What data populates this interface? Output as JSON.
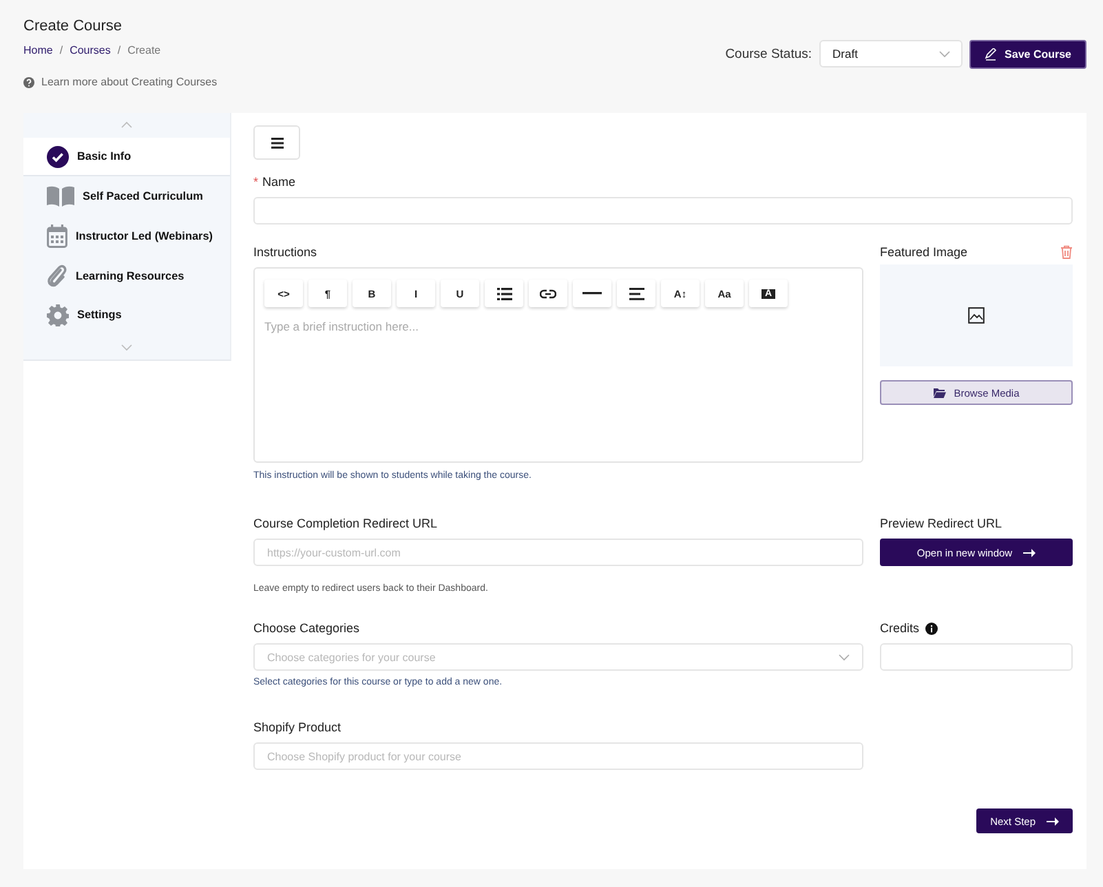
{
  "header": {
    "title": "Create Course",
    "breadcrumbs": [
      {
        "kind": "link",
        "label": "Home"
      },
      {
        "kind": "separator",
        "label": "/"
      },
      {
        "kind": "link",
        "label": "Courses"
      },
      {
        "kind": "separator",
        "label": "/"
      },
      {
        "kind": "current",
        "label": "Create"
      }
    ],
    "help_link": "Learn more about Creating Courses",
    "status_label": "Course Status:",
    "status_value": "Draft",
    "save_button": "Save Course"
  },
  "sidebar": {
    "items": [
      {
        "label": "Basic Info",
        "selected": true
      },
      {
        "label": "Self Paced Curriculum",
        "selected": false
      },
      {
        "label": "Instructor Led (Webinars)",
        "selected": false
      },
      {
        "label": "Learning Resources",
        "selected": false
      },
      {
        "label": "Settings",
        "selected": false
      }
    ]
  },
  "form": {
    "name_label": "Name",
    "required_mark": "*",
    "instructions_label": "Instructions",
    "toolbar": [
      {
        "kind": "text",
        "label": "<>"
      },
      {
        "kind": "text",
        "label": "¶"
      },
      {
        "kind": "text",
        "label": "B"
      },
      {
        "kind": "text",
        "label": "I"
      },
      {
        "kind": "text",
        "label": "U"
      },
      {
        "kind": "list"
      },
      {
        "kind": "link"
      },
      {
        "kind": "rule"
      },
      {
        "kind": "align"
      },
      {
        "kind": "text",
        "label": "A↕"
      },
      {
        "kind": "text",
        "label": "Aa"
      },
      {
        "kind": "inverse",
        "label": "A"
      }
    ],
    "instructions_placeholder": "Type a brief instruction here...",
    "instructions_help": "This instruction will be shown to students while taking the course.",
    "featured_image_label": "Featured Image",
    "browse_button": "Browse Media",
    "redirect_label": "Course Completion Redirect URL",
    "redirect_placeholder": "https://your-custom-url.com",
    "redirect_help": "Leave empty to redirect users back to their Dashboard.",
    "preview_label": "Preview Redirect URL",
    "preview_button": "Open in new window",
    "categories_label": "Choose Categories",
    "categories_placeholder": "Choose categories for your course",
    "categories_help": "Select categories for this course or type to add a new one.",
    "credits_label": "Credits",
    "shopify_label": "Shopify Product",
    "shopify_placeholder": "Choose Shopify product for your course",
    "next_button": "Next Step"
  }
}
